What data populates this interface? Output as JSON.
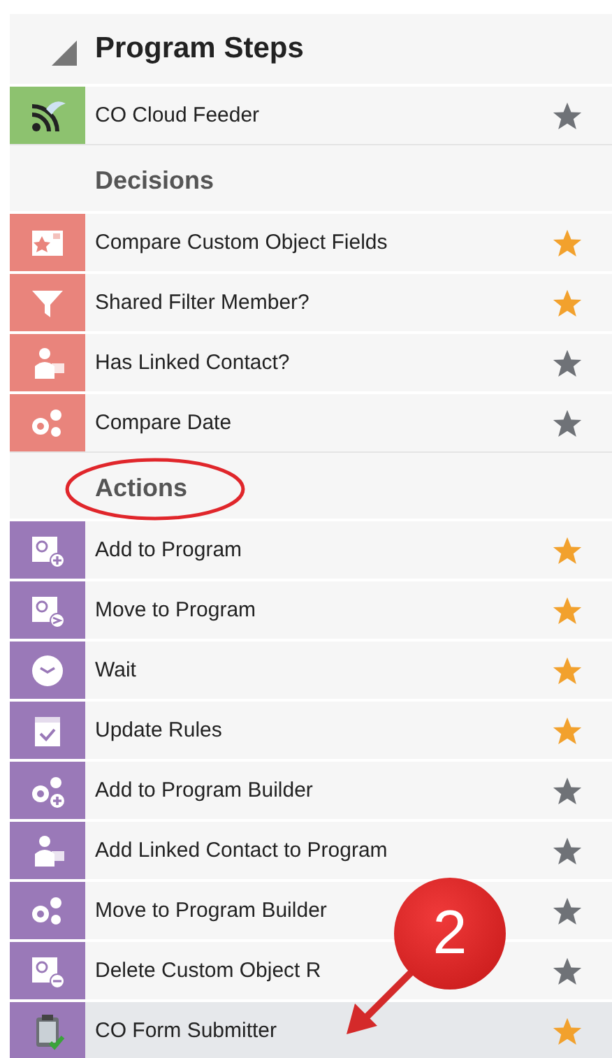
{
  "panel": {
    "title": "Program Steps",
    "expanded": true
  },
  "groups": [
    {
      "color": "#8dc26f",
      "items": [
        {
          "label": "CO Cloud Feeder",
          "kind": "feeder",
          "favorite": false,
          "selected": false
        }
      ]
    },
    {
      "header": "Decisions",
      "color": "#e9847c",
      "items": [
        {
          "label": "Compare Custom Object Fields",
          "kind": "compare-fields",
          "favorite": true,
          "selected": false
        },
        {
          "label": "Shared Filter Member?",
          "kind": "filter",
          "favorite": true,
          "selected": false
        },
        {
          "label": "Has Linked Contact?",
          "kind": "contact",
          "favorite": false,
          "selected": false
        },
        {
          "label": "Compare Date",
          "kind": "gears",
          "favorite": false,
          "selected": false
        }
      ]
    },
    {
      "header": "Actions",
      "circled": true,
      "color": "#9a79b8",
      "items": [
        {
          "label": "Add to Program",
          "kind": "doc-plus",
          "favorite": true,
          "selected": false
        },
        {
          "label": "Move to Program",
          "kind": "doc-move",
          "favorite": true,
          "selected": false
        },
        {
          "label": "Wait",
          "kind": "clock",
          "favorite": true,
          "selected": false
        },
        {
          "label": "Update Rules",
          "kind": "calendar",
          "favorite": true,
          "selected": false
        },
        {
          "label": "Add to Program Builder",
          "kind": "gears-plus",
          "favorite": false,
          "selected": false
        },
        {
          "label": "Add Linked Contact to Program",
          "kind": "contact",
          "favorite": false,
          "selected": false
        },
        {
          "label": "Move to Program Builder",
          "kind": "gears",
          "favorite": false,
          "selected": false
        },
        {
          "label": "Delete Custom Object R",
          "kind": "doc-minus",
          "favorite": false,
          "selected": false
        },
        {
          "label": "CO Form Submitter",
          "kind": "clipboard",
          "favorite": true,
          "selected": true
        }
      ]
    }
  ],
  "callout": {
    "badge": "2"
  }
}
